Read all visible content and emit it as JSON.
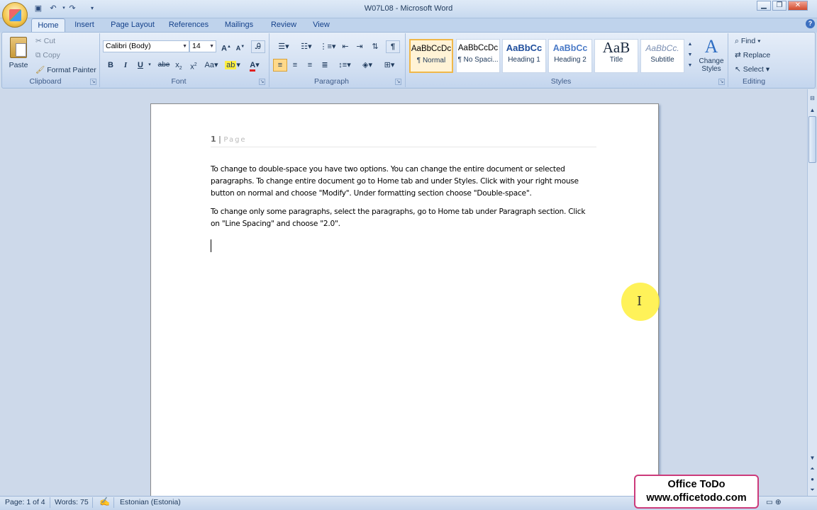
{
  "window": {
    "title": "W07L08 - Microsoft Word"
  },
  "qat": {
    "save_icon": "save-icon",
    "undo_icon": "undo-icon",
    "redo_icon": "redo-icon",
    "customize_icon": "customize-qat-icon"
  },
  "tabs": [
    {
      "label": "Home"
    },
    {
      "label": "Insert"
    },
    {
      "label": "Page Layout"
    },
    {
      "label": "References"
    },
    {
      "label": "Mailings"
    },
    {
      "label": "Review"
    },
    {
      "label": "View"
    }
  ],
  "clipboard": {
    "paste": "Paste",
    "cut": "Cut",
    "copy": "Copy",
    "format_painter": "Format Painter",
    "label": "Clipboard"
  },
  "font": {
    "name": "Calibri (Body)",
    "size": "14",
    "label": "Font"
  },
  "paragraph": {
    "label": "Paragraph"
  },
  "styles": {
    "items": [
      {
        "preview": "AaBbCcDc",
        "name": "¶ Normal"
      },
      {
        "preview": "AaBbCcDc",
        "name": "¶ No Spaci..."
      },
      {
        "preview": "AaBbCc",
        "name": "Heading 1"
      },
      {
        "preview": "AaBbCc",
        "name": "Heading 2"
      },
      {
        "preview": "AaB",
        "name": "Title"
      },
      {
        "preview": "AaBbCc.",
        "name": "Subtitle"
      }
    ],
    "change_styles": "Change Styles",
    "label": "Styles"
  },
  "editing": {
    "find": "Find",
    "replace": "Replace",
    "select": "Select",
    "label": "Editing"
  },
  "document": {
    "header_num": "1",
    "header_sep": "|",
    "header_page": "Page",
    "p1": "To change to double-space you have two options. You can change the entire document or selected paragraphs. To change entire document go to Home tab and under Styles. Click with your right mouse button on normal and choose \"Modify\". Under formatting section choose \"Double-space\".",
    "p2": "To change only some paragraphs, select the paragraphs, go to Home tab under Paragraph section. Click on \"Line Spacing\" and choose \"2.0\"."
  },
  "status": {
    "page": "Page: 1 of 4",
    "words": "Words: 75",
    "language": "Estonian (Estonia)"
  },
  "watermark": {
    "line1": "Office ToDo",
    "line2": "www.officetodo.com"
  },
  "colors": {
    "accent": "#15428b",
    "ribbon": "#d0def1",
    "highlight": "#f0b84a",
    "font_color": "#e02020"
  }
}
